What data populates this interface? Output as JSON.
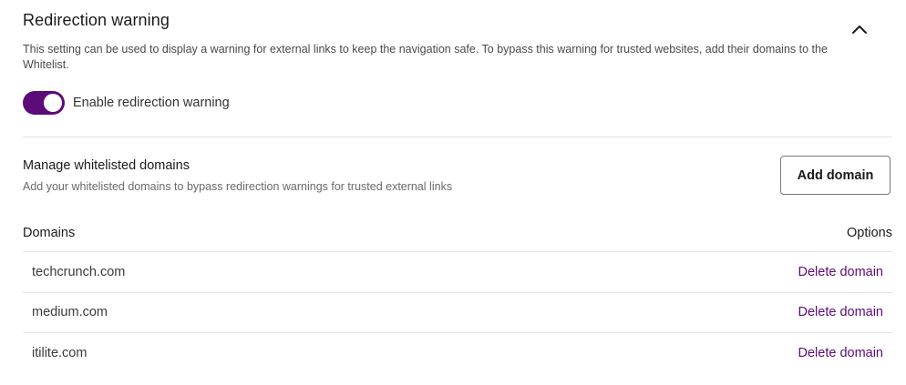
{
  "section": {
    "title": "Redirection warning",
    "description": "This setting can be used to display a warning for external links to keep the navigation safe. To bypass this warning for trusted websites, add their domains to the Whitelist.",
    "collapse_icon": "chevron-up-icon"
  },
  "toggle": {
    "label": "Enable redirection warning",
    "enabled": true,
    "color": "#5c0b78"
  },
  "whitelist": {
    "title": "Manage whitelisted domains",
    "subtitle": "Add your whitelisted domains to bypass redirection warnings for trusted external links",
    "add_button_label": "Add domain"
  },
  "table": {
    "headers": {
      "domains": "Domains",
      "options": "Options"
    },
    "rows": [
      {
        "domain": "techcrunch.com",
        "action": "Delete domain"
      },
      {
        "domain": "medium.com",
        "action": "Delete domain"
      },
      {
        "domain": "itilite.com",
        "action": "Delete domain"
      }
    ]
  },
  "colors": {
    "accent": "#5c0b78",
    "divider": "#e3e3e3"
  }
}
